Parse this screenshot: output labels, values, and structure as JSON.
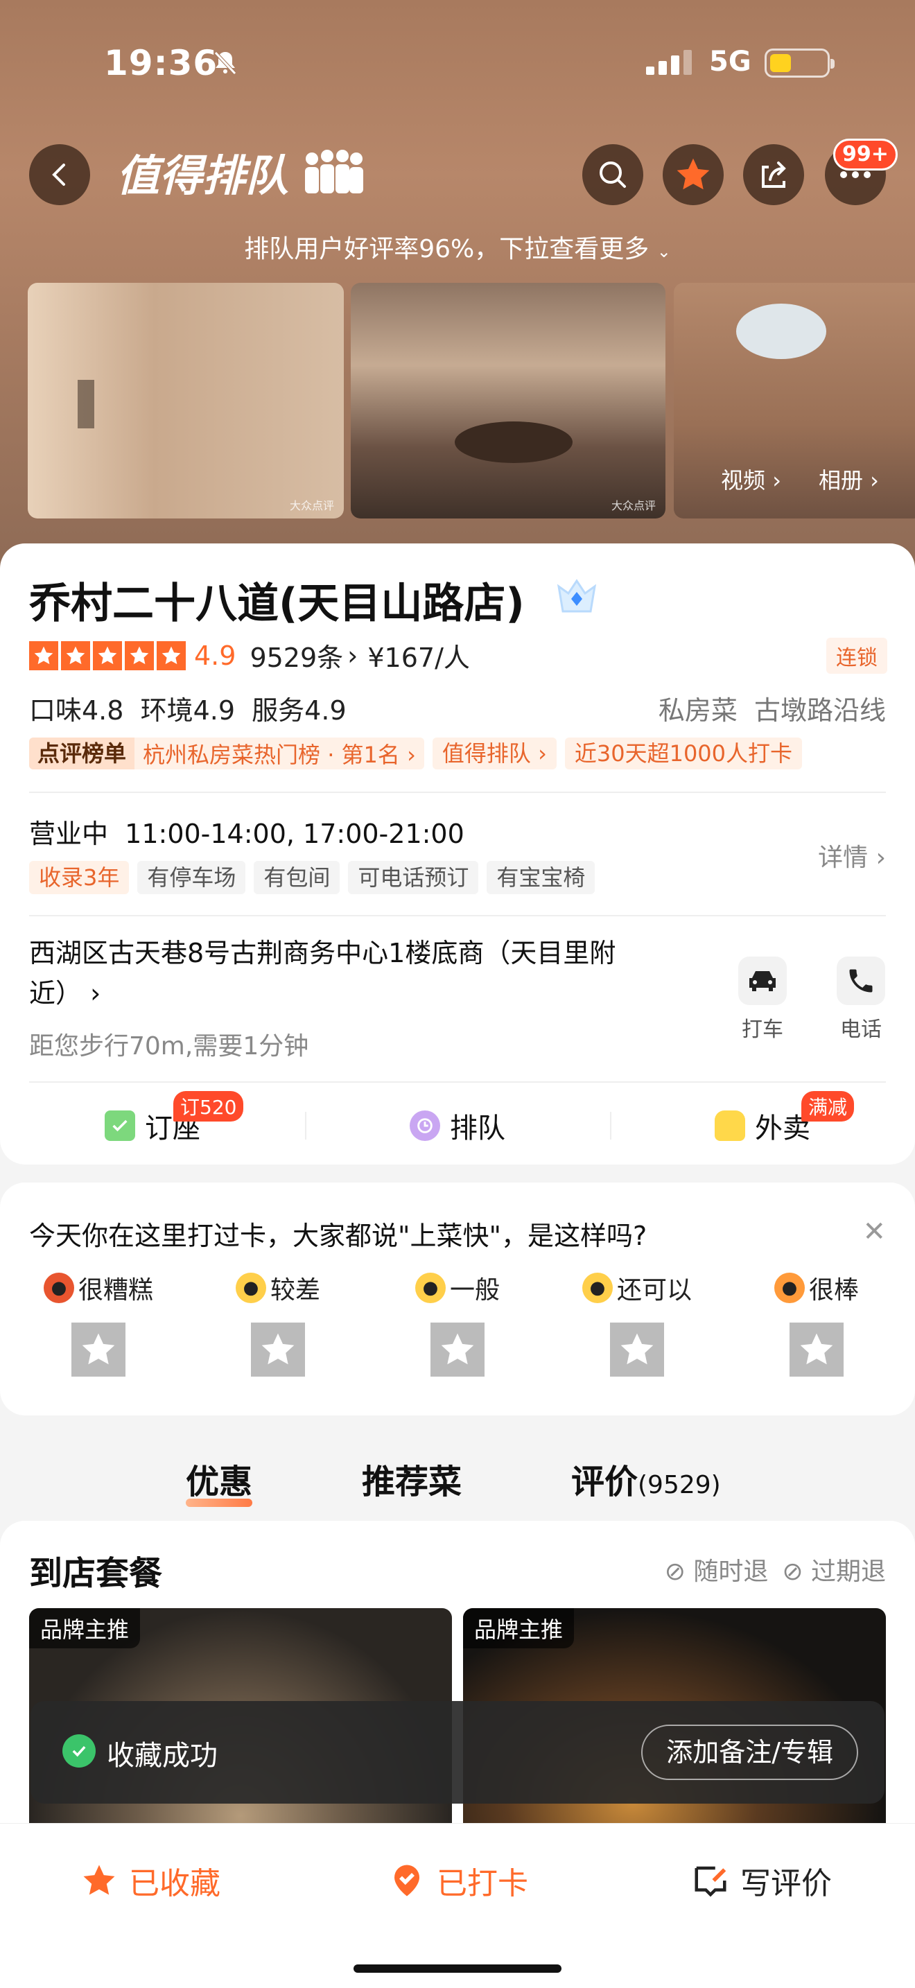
{
  "status": {
    "time": "19:36",
    "network": "5G"
  },
  "header": {
    "brand": "值得排队",
    "notif_badge": "99+",
    "subline": "排队用户好评率96%，下拉查看更多"
  },
  "photos": {
    "watermark": "大众点评",
    "video": "视频",
    "album": "相册"
  },
  "shop": {
    "name": "乔村二十八道(天目山路店)",
    "score": "4.9",
    "reviews": "9529条",
    "price": "¥167/人",
    "chain": "连锁",
    "subscores": "口味4.8  环境4.9  服务4.9",
    "cuisine": "私房菜  古墩路沿线",
    "rank_label": "点评榜单",
    "rank_value": "杭州私房菜热门榜 · 第1名",
    "tag_queue": "值得排队",
    "tag_checkin": "近30天超1000人打卡",
    "hours": "营业中  11:00-14:00, 17:00-21:00",
    "detail": "详情",
    "tags": [
      "收录3年",
      "有停车场",
      "有包间",
      "可电话预订",
      "有宝宝椅"
    ],
    "address": "西湖区古天巷8号古荆商务中心1楼底商（天目里附近）",
    "walk": "距您步行70m,需要1分钟",
    "taxi": "打车",
    "phone": "电话"
  },
  "actions": {
    "booking": "订座",
    "booking_badge": "订520",
    "queue": "排队",
    "delivery": "外卖",
    "delivery_badge": "满减"
  },
  "checkin": {
    "question": "今天你在这里打过卡，大家都说\"上菜快\"，是这样吗?",
    "moods": [
      "很糟糕",
      "较差",
      "一般",
      "还可以",
      "很棒"
    ]
  },
  "section_tabs": {
    "deals": "优惠",
    "dishes": "推荐菜",
    "reviews": "评价",
    "reviews_count": "(9529)"
  },
  "deals": {
    "title": "到店套餐",
    "refund1": "随时退",
    "refund2": "过期退",
    "label": "品牌主推"
  },
  "toast": {
    "message": "收藏成功",
    "button": "添加备注/专辑"
  },
  "bottom": {
    "saved": "已收藏",
    "checked": "已打卡",
    "write": "写评价"
  },
  "colors": {
    "accent": "#ff6a2a",
    "hero": "#a87a5e"
  }
}
